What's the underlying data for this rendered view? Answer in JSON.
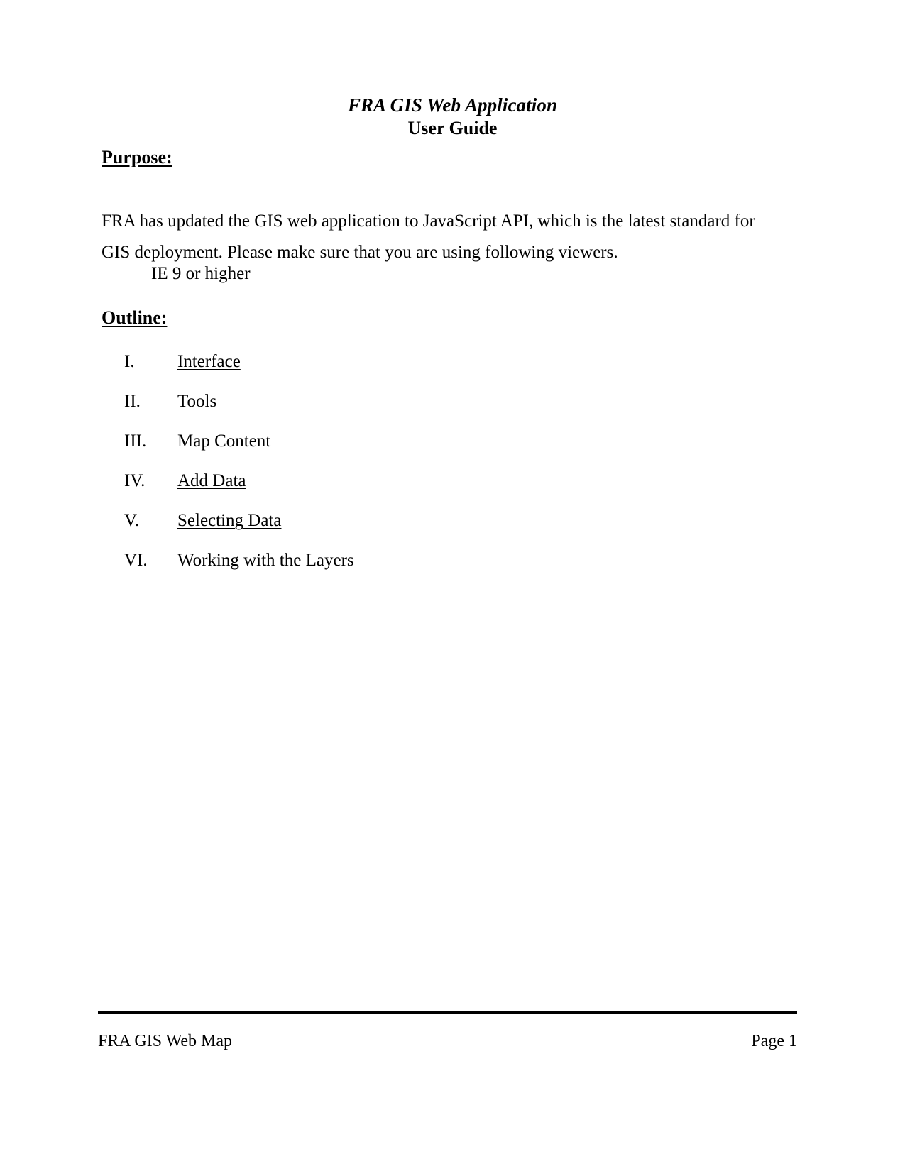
{
  "document": {
    "title": "FRA GIS Web Application",
    "subtitle": "User Guide"
  },
  "purpose": {
    "heading": "Purpose:",
    "paragraph": "FRA has updated the GIS web application to JavaScript API, which is the latest standard for GIS deployment.  Please make sure that you are using following viewers.",
    "requirement": "IE 9 or higher"
  },
  "outline": {
    "heading": "Outline:",
    "items": [
      {
        "numeral": "I.",
        "label": "Interface"
      },
      {
        "numeral": "II.",
        "label": "Tools"
      },
      {
        "numeral": "III.",
        "label": "Map Content"
      },
      {
        "numeral": "IV.",
        "label": "Add Data"
      },
      {
        "numeral": "V.",
        "label": "Selecting Data"
      },
      {
        "numeral": "VI.",
        "label": "Working with the Layers"
      }
    ]
  },
  "footer": {
    "left": "FRA GIS Web Map",
    "right": "Page 1"
  }
}
